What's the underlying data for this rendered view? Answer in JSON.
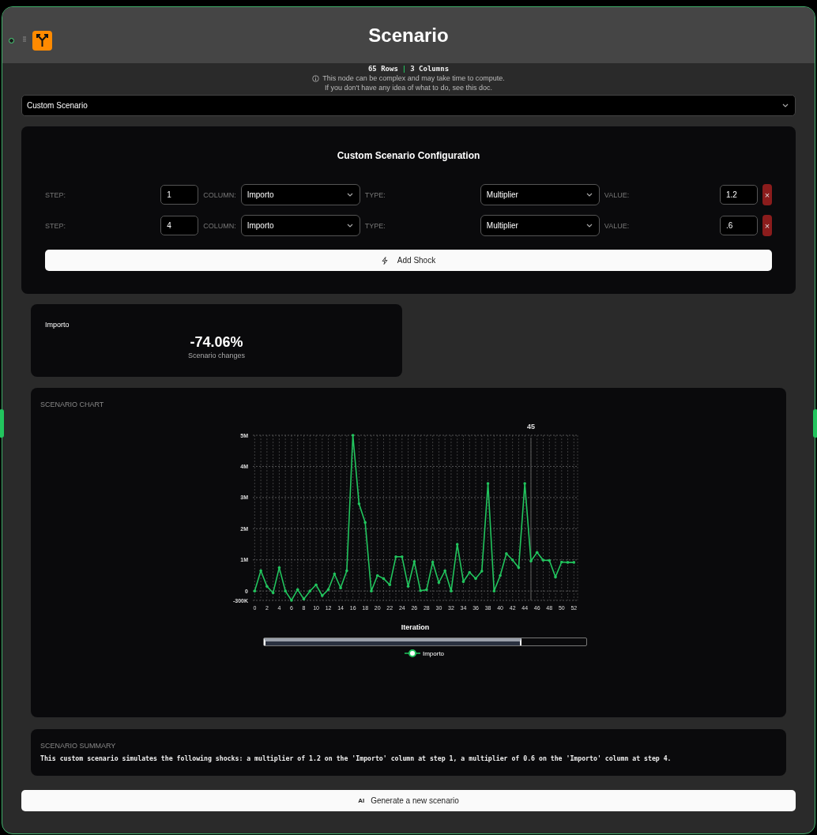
{
  "node": {
    "title": "Scenario"
  },
  "info": {
    "rows": "65 Rows",
    "separator": "|",
    "columns": "3 Columns",
    "notice": "This node can be complex and may take time to compute.",
    "help": "If you don't have any idea of what to do, see this doc."
  },
  "scenario_select": {
    "value": "Custom Scenario"
  },
  "config": {
    "title": "Custom Scenario Configuration",
    "shocks": [
      {
        "step_label": "STEP:",
        "step": "1",
        "column_label": "COLUMN:",
        "column": "Importo",
        "type_label": "TYPE:",
        "type": "Multiplier",
        "value_label": "VALUE:",
        "value": "1.2",
        "delete": "×"
      },
      {
        "step_label": "STEP:",
        "step": "4",
        "column_label": "COLUMN:",
        "column": "Importo",
        "type_label": "TYPE:",
        "type": "Multiplier",
        "value_label": "VALUE:",
        "value": ".6",
        "delete": "×"
      }
    ],
    "add_button": "Add Shock"
  },
  "metric": {
    "label": "Importo",
    "value": "-74.06%",
    "caption": "Scenario changes"
  },
  "chart": {
    "title": "SCENARIO CHART",
    "chart_data": {
      "type": "line",
      "xlabel": "Iteration",
      "x": [
        0,
        1,
        2,
        3,
        4,
        5,
        6,
        7,
        8,
        9,
        10,
        11,
        12,
        13,
        14,
        15,
        16,
        17,
        18,
        19,
        20,
        21,
        22,
        23,
        24,
        25,
        26,
        27,
        28,
        29,
        30,
        31,
        32,
        33,
        34,
        35,
        36,
        37,
        38,
        39,
        40,
        41,
        42,
        43,
        44,
        45,
        46,
        47,
        48,
        49,
        50,
        51,
        52
      ],
      "series": [
        {
          "name": "Importo",
          "color": "#22c55e",
          "values": [
            0,
            650000,
            150000,
            -60000,
            750000,
            0,
            -300000,
            50000,
            -260000,
            0,
            200000,
            -150000,
            50000,
            550000,
            100000,
            650000,
            5000000,
            2800000,
            2200000,
            0,
            500000,
            400000,
            200000,
            1100000,
            1100000,
            150000,
            950000,
            10000,
            40000,
            930000,
            270000,
            650000,
            0,
            1500000,
            300000,
            600000,
            400000,
            640000,
            3450000,
            0,
            500000,
            1200000,
            1000000,
            750000,
            3450000,
            960000,
            1240000,
            990000,
            980000,
            450000,
            930000,
            920000,
            920000
          ]
        }
      ],
      "xlim": [
        -0.3,
        52.6
      ],
      "ylim": [
        -300000,
        5000000
      ],
      "grid": true,
      "xticks": [
        0,
        2,
        4,
        6,
        8,
        10,
        12,
        14,
        16,
        18,
        20,
        22,
        24,
        26,
        28,
        30,
        32,
        34,
        36,
        38,
        40,
        42,
        44,
        46,
        48,
        50,
        52
      ],
      "yticks": [
        {
          "value": -300000,
          "label": "-300K"
        },
        {
          "value": 0,
          "label": "0"
        },
        {
          "value": 1000000,
          "label": "1M"
        },
        {
          "value": 2000000,
          "label": "2M"
        },
        {
          "value": 3000000,
          "label": "3M"
        },
        {
          "value": 4000000,
          "label": "4M"
        },
        {
          "value": 5000000,
          "label": "5M"
        }
      ],
      "ref_lines": [
        {
          "axis": "x",
          "value": 45
        }
      ],
      "annotations": [
        {
          "x": 45,
          "text": "45"
        }
      ]
    },
    "zoom": {
      "level": 0.8
    }
  },
  "summary": {
    "title": "SCENARIO SUMMARY",
    "text": "This custom scenario simulates the following shocks: a multiplier of 1.2 on the 'Importo' column at step 1, a multiplier of 0.6 on the 'Importo' column at step 4."
  },
  "generate_button": {
    "icon": "AI",
    "label": "Generate a new scenario"
  }
}
